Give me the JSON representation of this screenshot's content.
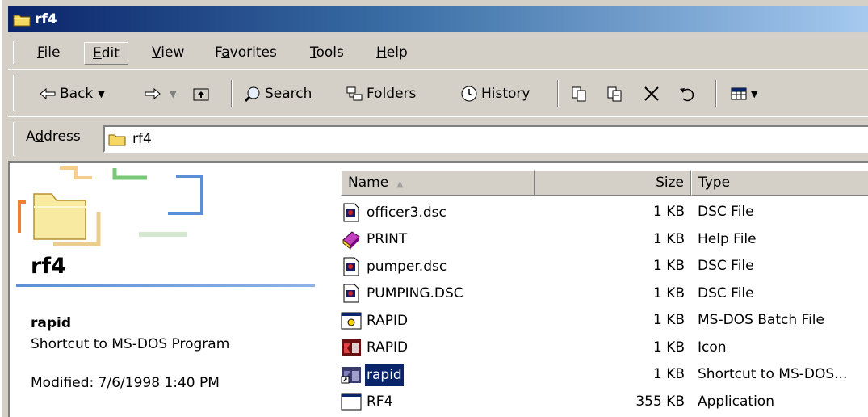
{
  "window": {
    "title": "rf4"
  },
  "menu": {
    "items": [
      {
        "pre": "",
        "u": "F",
        "post": "ile"
      },
      {
        "pre": "",
        "u": "E",
        "post": "dit"
      },
      {
        "pre": "",
        "u": "V",
        "post": "iew"
      },
      {
        "pre": "F",
        "u": "a",
        "post": "vorites"
      },
      {
        "pre": "",
        "u": "T",
        "post": "ools"
      },
      {
        "pre": "",
        "u": "H",
        "post": "elp"
      }
    ]
  },
  "toolbar": {
    "back": "Back",
    "search": "Search",
    "folders": "Folders",
    "history": "History"
  },
  "address": {
    "label_pre": "A",
    "label_u": "d",
    "label_post": "dress",
    "value": "rf4"
  },
  "left_pane": {
    "folder_title": "rf4",
    "selected_name": "rapid",
    "selected_type": "Shortcut to MS-DOS Program",
    "modified": "Modified: 7/6/1998 1:40 PM"
  },
  "columns": {
    "name": "Name",
    "size": "Size",
    "type": "Type"
  },
  "files": [
    {
      "name": "officer3.dsc",
      "size": "1 KB",
      "type": "DSC File",
      "icon": "dsc-file-icon"
    },
    {
      "name": "PRINT",
      "size": "1 KB",
      "type": "Help File",
      "icon": "help-book-icon"
    },
    {
      "name": "pumper.dsc",
      "size": "1 KB",
      "type": "DSC File",
      "icon": "dsc-file-icon"
    },
    {
      "name": "PUMPING.DSC",
      "size": "1 KB",
      "type": "DSC File",
      "icon": "dsc-file-icon"
    },
    {
      "name": "RAPID",
      "size": "1 KB",
      "type": "MS-DOS Batch File",
      "icon": "batch-file-icon"
    },
    {
      "name": "RAPID",
      "size": "1 KB",
      "type": "Icon",
      "icon": "icon-file-icon"
    },
    {
      "name": "rapid",
      "size": "1 KB",
      "type": "Shortcut to MS-DOS...",
      "icon": "shortcut-icon",
      "selected": true
    },
    {
      "name": "RF4",
      "size": "355 KB",
      "type": "Application",
      "icon": "application-icon"
    }
  ],
  "colors": {
    "title_start": "#0a246a",
    "title_end": "#a6caf0",
    "selection": "#0a246a",
    "face": "#d4d0c8"
  }
}
